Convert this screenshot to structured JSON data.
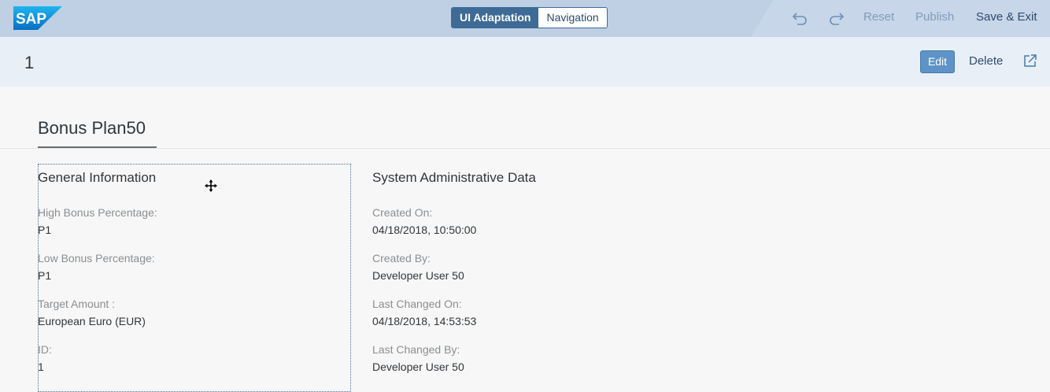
{
  "toolbar": {
    "logo_text": "SAP",
    "mode_tabs": [
      "UI Adaptation",
      "Navigation"
    ],
    "active_mode": "UI Adaptation",
    "undo_icon": "undo-icon",
    "redo_icon": "redo-icon",
    "reset_label": "Reset",
    "publish_label": "Publish",
    "save_exit_label": "Save & Exit",
    "colors": {
      "background": "#bfd0e4",
      "active_tab": "#3e6a96"
    }
  },
  "header": {
    "object_title": "1",
    "edit_label": "Edit",
    "delete_label": "Delete",
    "share_icon": "share-icon"
  },
  "section": {
    "title": "Bonus Plan50"
  },
  "general": {
    "title": "General Information",
    "fields": [
      {
        "label": "High Bonus Percentage:",
        "value": "P1"
      },
      {
        "label": "Low Bonus Percentage:",
        "value": "P1"
      },
      {
        "label": "Target Amount :",
        "value": "European Euro (EUR)"
      },
      {
        "label": "ID:",
        "value": "1"
      }
    ]
  },
  "admin": {
    "title": "System Administrative Data",
    "fields": [
      {
        "label": "Created On:",
        "value": "04/18/2018, 10:50:00"
      },
      {
        "label": "Created By:",
        "value": "Developer User 50"
      },
      {
        "label": "Last Changed On:",
        "value": "04/18/2018, 14:53:53"
      },
      {
        "label": "Last Changed By:",
        "value": "Developer User 50"
      }
    ]
  }
}
